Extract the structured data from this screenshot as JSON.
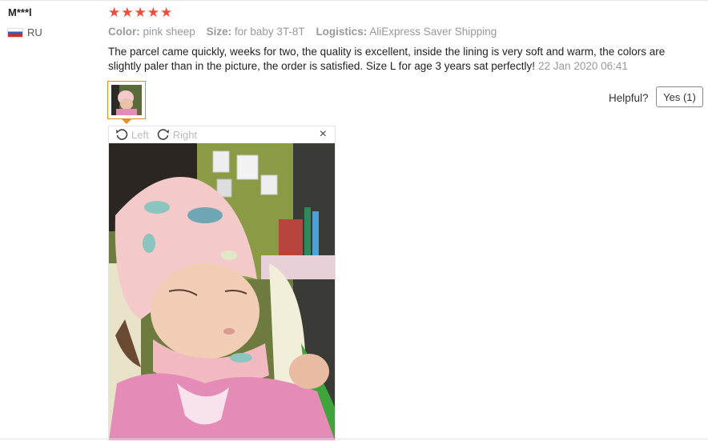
{
  "user": {
    "name": "M***l",
    "country": "RU"
  },
  "rating": {
    "stars": 5,
    "max": 5
  },
  "meta": {
    "color_label": "Color:",
    "color_value": "pink sheep",
    "size_label": "Size:",
    "size_value": "for baby 3T-8T",
    "logistics_label": "Logistics:",
    "logistics_value": "AliExpress Saver Shipping"
  },
  "review": {
    "text": "The parcel came quickly, weeks for two, the quality is excellent, inside the lining is very soft and warm, the colors are slightly paler than in the picture, the order is satisfied. Size L for age 3 years sat perfectly!",
    "date": "22 Jan 2020 06:41"
  },
  "helpful": {
    "label": "Helpful?",
    "yes_label": "Yes (1)"
  },
  "viewer": {
    "left_label": "Left",
    "right_label": "Right",
    "close": "×"
  },
  "colors": {
    "star": "#f04b3b",
    "thumb_border": "#e88b23",
    "hat": "#f4c9c9",
    "shirt": "#e58bb7"
  }
}
